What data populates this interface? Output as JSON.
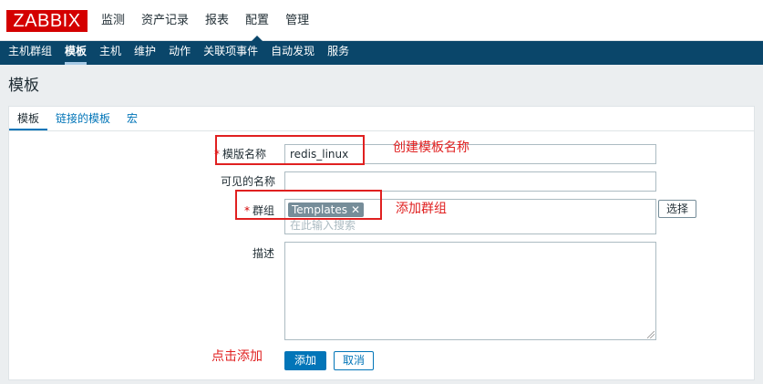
{
  "header": {
    "logo": "ZABBIX",
    "nav": [
      {
        "label": "监测"
      },
      {
        "label": "资产记录"
      },
      {
        "label": "报表"
      },
      {
        "label": "配置"
      },
      {
        "label": "管理"
      }
    ],
    "active_index": 3
  },
  "subnav": {
    "items": [
      {
        "label": "主机群组"
      },
      {
        "label": "模板"
      },
      {
        "label": "主机"
      },
      {
        "label": "维护"
      },
      {
        "label": "动作"
      },
      {
        "label": "关联项事件"
      },
      {
        "label": "自动发现"
      },
      {
        "label": "服务"
      }
    ],
    "active_index": 1
  },
  "page": {
    "title": "模板"
  },
  "tabs": [
    {
      "label": "模板"
    },
    {
      "label": "链接的模板"
    },
    {
      "label": "宏"
    }
  ],
  "form": {
    "template_name_label": "模版名称",
    "template_name_value": "redis_linux",
    "visible_name_label": "可见的名称",
    "visible_name_value": "",
    "groups_label": "群组",
    "groups_chip": "Templates",
    "groups_placeholder": "在此输入搜索",
    "select_button": "选择",
    "description_label": "描述",
    "description_value": "",
    "add_button": "添加",
    "cancel_button": "取消",
    "required_marker": "*"
  },
  "annotations": {
    "create_name": "创建模板名称",
    "add_group": "添加群组",
    "click_add": "点击添加"
  },
  "colors": {
    "brand_red": "#d40000",
    "subnav_bg": "#0a466a",
    "link_blue": "#0275b8",
    "annotation_red": "#e02020"
  }
}
